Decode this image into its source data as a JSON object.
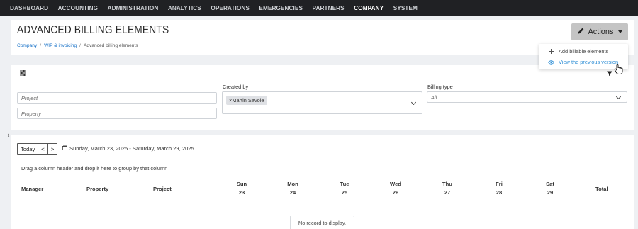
{
  "nav": {
    "items": [
      "DASHBOARD",
      "ACCOUNTING",
      "ADMINISTRATION",
      "ANALYTICS",
      "OPERATIONS",
      "EMERGENCIES",
      "PARTNERS",
      "COMPANY",
      "SYSTEM"
    ],
    "active": "COMPANY"
  },
  "header": {
    "title": "ADVANCED BILLING ELEMENTS",
    "breadcrumb": [
      "Company",
      "WIP & invoicing",
      "Advanced billing elements"
    ],
    "actions_label": "Actions"
  },
  "actions_menu": {
    "items": [
      {
        "label": "Add billable elements",
        "icon": "plus-icon"
      },
      {
        "label": "View the previous version",
        "icon": "eye-icon"
      }
    ]
  },
  "filters": {
    "project_placeholder": "Project",
    "property_placeholder": "Property",
    "created_by_label": "Created by",
    "created_by_chip": "×Martin Savoie",
    "billing_type_label": "Billing type",
    "billing_type_placeholder": "All"
  },
  "grid": {
    "today_label": "Today",
    "prev_label": "<",
    "next_label": ">",
    "date_range": "Sunday, March 23, 2025 - Saturday, March 29, 2025",
    "group_hint": "Drag a column header and drop it here to group by that column",
    "columns": [
      "Manager",
      "Property",
      "Project"
    ],
    "days": [
      {
        "name": "Sun",
        "num": "23"
      },
      {
        "name": "Mon",
        "num": "24"
      },
      {
        "name": "Tue",
        "num": "25"
      },
      {
        "name": "Wed",
        "num": "26"
      },
      {
        "name": "Thu",
        "num": "27"
      },
      {
        "name": "Fri",
        "num": "28"
      },
      {
        "name": "Sat",
        "num": "29"
      }
    ],
    "total_label": "Total",
    "empty_message": "No record to display."
  },
  "colors": {
    "nav_bg": "#202124",
    "accent_link": "#1a73c8",
    "hover_item": "#2f8fd6",
    "actions_bg": "#c4c4c4"
  }
}
